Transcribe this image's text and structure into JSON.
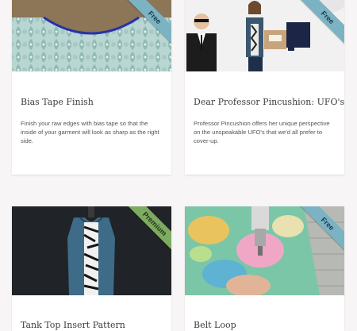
{
  "cards": [
    {
      "title": "Bias Tape Finish",
      "description": "Finish your raw edges with bias tape so that the inside of your garment will look as sharp as the right side.",
      "badge": "Free",
      "image": "garment-neckline-photo"
    },
    {
      "title": "Dear Professor Pincushion: UFO's",
      "description": "Professor Pincushion offers her unique perspective on the unspeakable UFO's that we'd all prefer to cover-up.",
      "badge": "Free",
      "image": "presenter-with-agent-photo"
    },
    {
      "title": "Tank Top Insert Pattern",
      "description": "",
      "badge": "Premium",
      "image": "tank-top-on-dress-form-photo"
    },
    {
      "title": "Belt Loop",
      "description": "",
      "badge": "Free",
      "image": "sewing-machine-photo"
    }
  ],
  "colors": {
    "page_background": "#f7f5f6",
    "free_badge": "#7bb3c4",
    "premium_badge": "#7dab5f"
  }
}
